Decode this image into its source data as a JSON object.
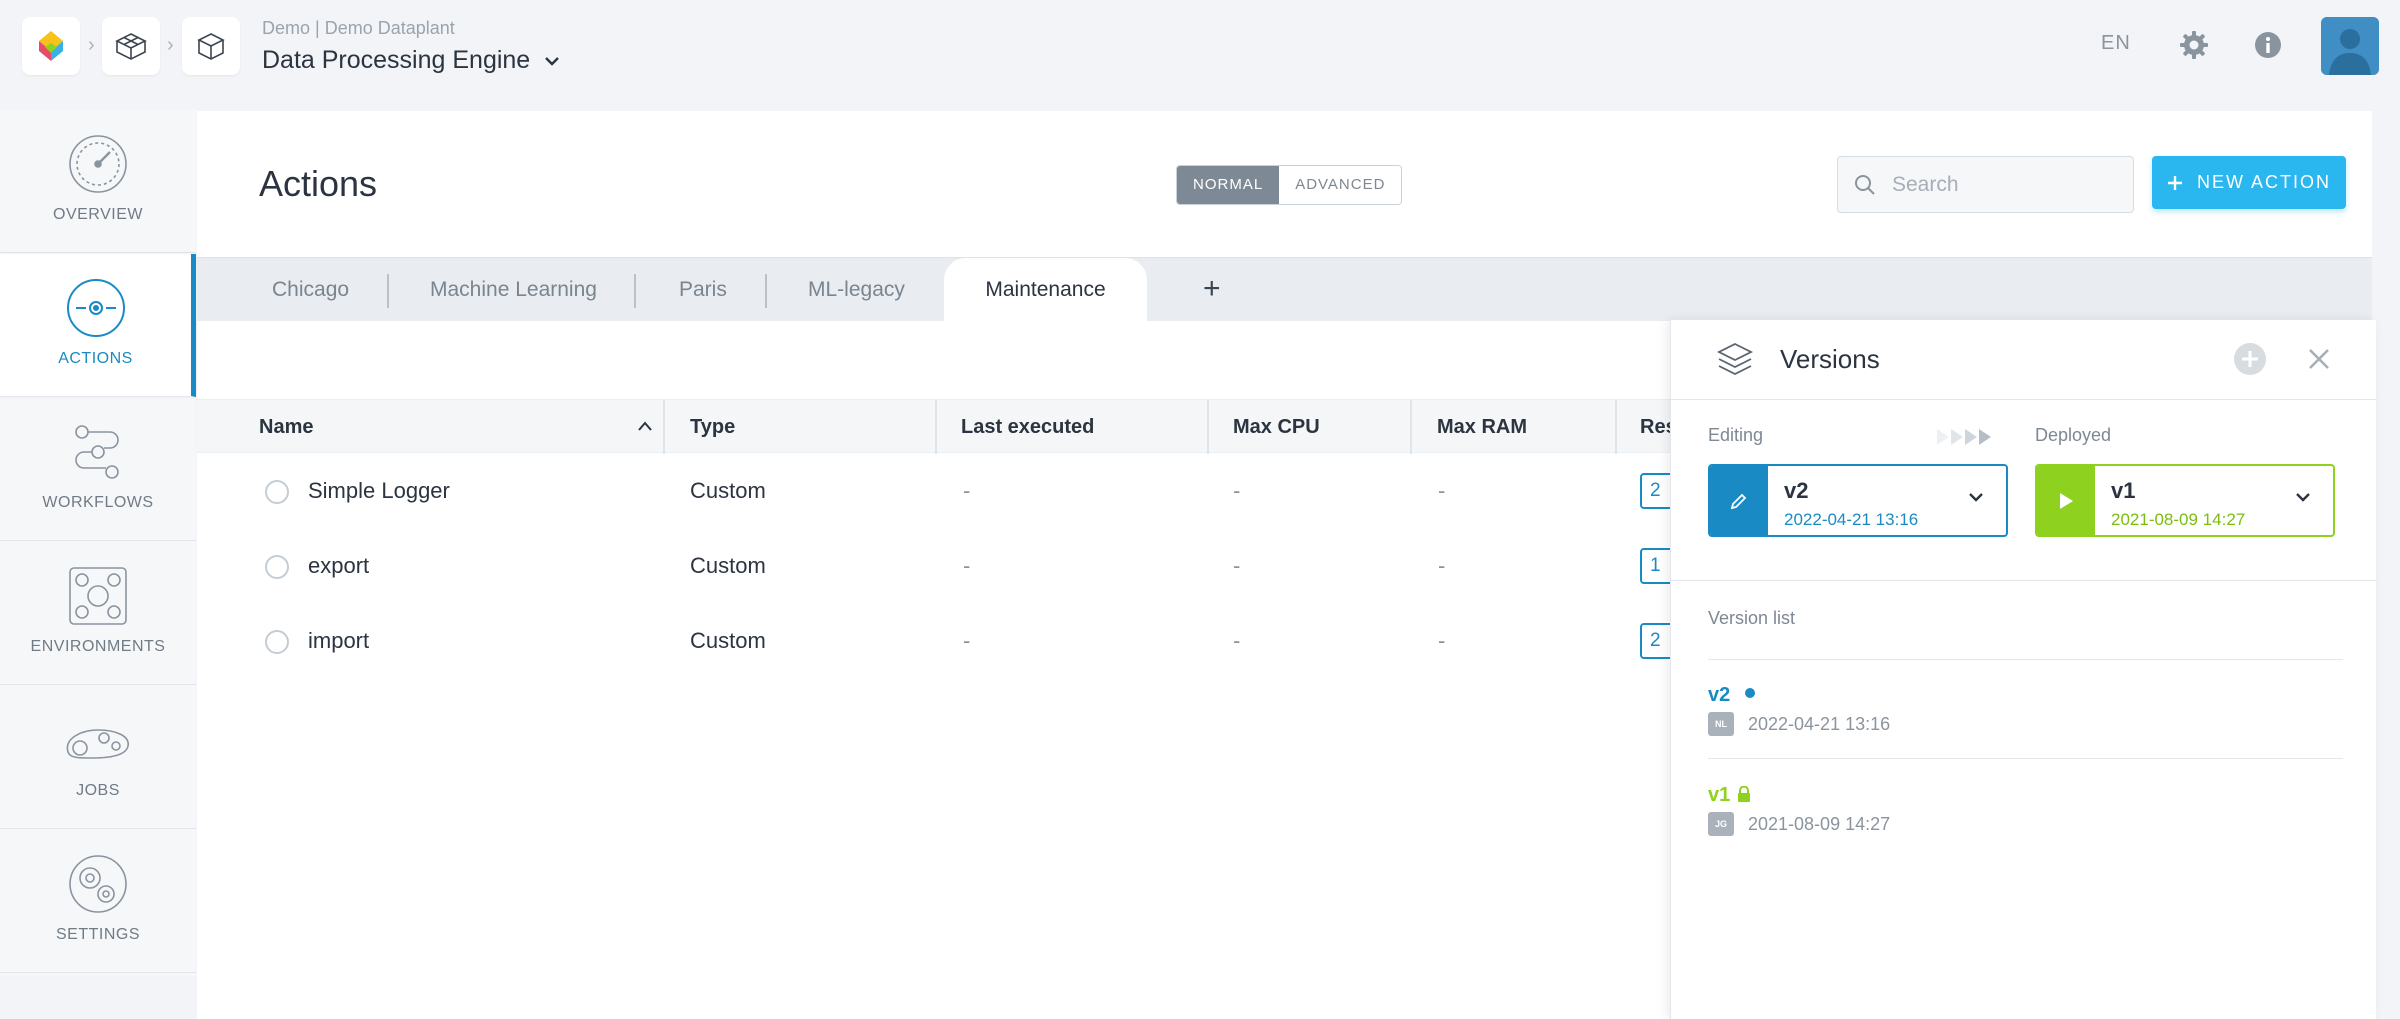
{
  "breadcrumb": {
    "org": "Demo",
    "project": "Demo Dataplant",
    "separator": "|",
    "app_title": "Data Processing Engine"
  },
  "topbar": {
    "language": "EN",
    "icons": [
      "settings-icon",
      "info-icon",
      "user-avatar"
    ]
  },
  "sidebar": {
    "items": [
      {
        "label": "OVERVIEW",
        "icon": "gauge-icon",
        "active": false
      },
      {
        "label": "ACTIONS",
        "icon": "actions-icon",
        "active": true
      },
      {
        "label": "WORKFLOWS",
        "icon": "workflow-icon",
        "active": false
      },
      {
        "label": "ENVIRONMENTS",
        "icon": "environment-icon",
        "active": false
      },
      {
        "label": "JOBS",
        "icon": "jobs-icon",
        "active": false
      },
      {
        "label": "SETTINGS",
        "icon": "settings-icon",
        "active": false
      }
    ]
  },
  "page": {
    "title": "Actions",
    "mode_normal": "NORMAL",
    "mode_advanced": "ADVANCED",
    "search_placeholder": "Search",
    "new_action_label": "NEW ACTION"
  },
  "tabs": [
    {
      "label": "Chicago"
    },
    {
      "label": "Machine Learning"
    },
    {
      "label": "Paris"
    },
    {
      "label": "ML-legacy"
    },
    {
      "label": "Maintenance",
      "active": true
    }
  ],
  "table": {
    "columns": [
      "Name",
      "Type",
      "Last executed",
      "Max CPU",
      "Max RAM",
      "Res"
    ],
    "rows": [
      {
        "name": "Simple Logger",
        "type": "Custom",
        "last_executed": "-",
        "max_cpu": "-",
        "max_ram": "-",
        "res": "2"
      },
      {
        "name": "export",
        "type": "Custom",
        "last_executed": "-",
        "max_cpu": "-",
        "max_ram": "-",
        "res": "1"
      },
      {
        "name": "import",
        "type": "Custom",
        "last_executed": "-",
        "max_cpu": "-",
        "max_ram": "-",
        "res": "2"
      }
    ]
  },
  "versions": {
    "title": "Versions",
    "editing_label": "Editing",
    "deployed_label": "Deployed",
    "editing": {
      "name": "v2",
      "date": "2022-04-21 13:16"
    },
    "deployed": {
      "name": "v1",
      "date": "2021-08-09 14:27"
    },
    "list_label": "Version list",
    "list": [
      {
        "name": "v2",
        "user": "NL",
        "date": "2022-04-21 13:16",
        "status": "editing"
      },
      {
        "name": "v1",
        "user": "JG",
        "date": "2021-08-09 14:27",
        "status": "deployed-locked"
      }
    ]
  },
  "colors": {
    "accent_blue": "#1a8ac4",
    "button_cyan": "#2ab6ef",
    "deployed_green": "#8ed11e"
  }
}
